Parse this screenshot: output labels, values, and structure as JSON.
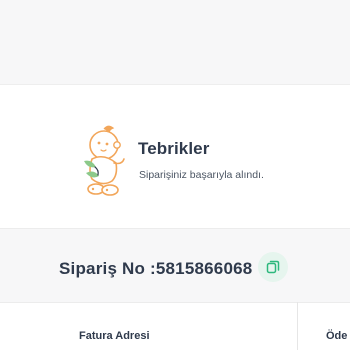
{
  "success": {
    "title": "Tebrikler",
    "message": "Siparişiniz başarıyla alındı.",
    "illustration": "baby-icon"
  },
  "order": {
    "label": "Sipariş No :5815866068",
    "copy_icon": "copy-icon"
  },
  "sections": {
    "billing_address": "Fatura Adresi",
    "payment": "Öde"
  },
  "colors": {
    "accent": "#2db87d",
    "copy_bg": "#e6f5ee",
    "text": "#2f3a4c"
  }
}
